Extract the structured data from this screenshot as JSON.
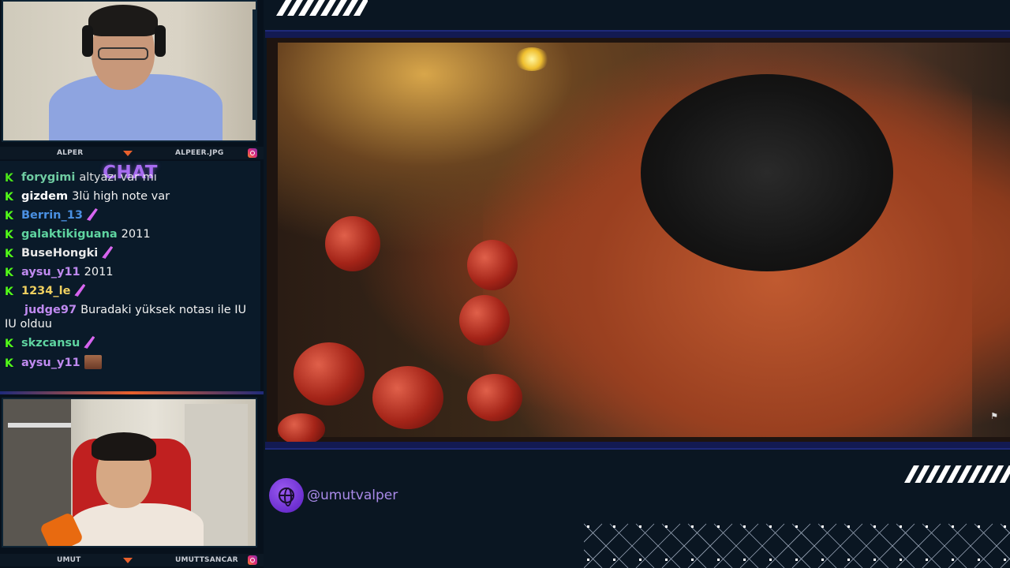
{
  "cams": {
    "top": {
      "left_name": "ALPER",
      "right_name": "ALPEER.JPG"
    },
    "bottom": {
      "left_name": "UMUT",
      "right_name": "UMUTTSANCAR"
    }
  },
  "chat": {
    "title": "CHAT",
    "messages": [
      {
        "user": "forygimi",
        "user_color": "#7be0b0",
        "text": "altyazı var mı",
        "emote": ""
      },
      {
        "user": "gizdem",
        "user_color": "#ffffff",
        "text": "3lü high note var",
        "emote": ""
      },
      {
        "user": "Berrin_13",
        "user_color": "#4a90e2",
        "text": "",
        "emote": "feather"
      },
      {
        "user": "galaktikiguana",
        "user_color": "#5fd4a0",
        "text": "2011",
        "emote": ""
      },
      {
        "user": "BuseHongki",
        "user_color": "#e8e8e8",
        "text": "",
        "emote": "feather"
      },
      {
        "user": "aysu_y11",
        "user_color": "#c08af0",
        "text": "2011",
        "emote": ""
      },
      {
        "user": "1234_le",
        "user_color": "#f0d060",
        "text": "",
        "emote": "feather"
      },
      {
        "user": "judge97",
        "user_color": "#c08af0",
        "text": "Buradaki yüksek notası ile IU IU olduu",
        "emote": ""
      },
      {
        "user": "skzcansu",
        "user_color": "#5fd4a0",
        "text": "",
        "emote": "feather"
      },
      {
        "user": "aysu_y11",
        "user_color": "#c08af0",
        "text": "",
        "emote": "face"
      }
    ]
  },
  "social": {
    "handle": "@umutvalper",
    "icon": "globe-icon"
  },
  "colors": {
    "accent_orange": "#e8602c",
    "accent_purple": "#8a4ee6",
    "kick_green": "#53fc18",
    "strip_blue": "#131a52"
  }
}
